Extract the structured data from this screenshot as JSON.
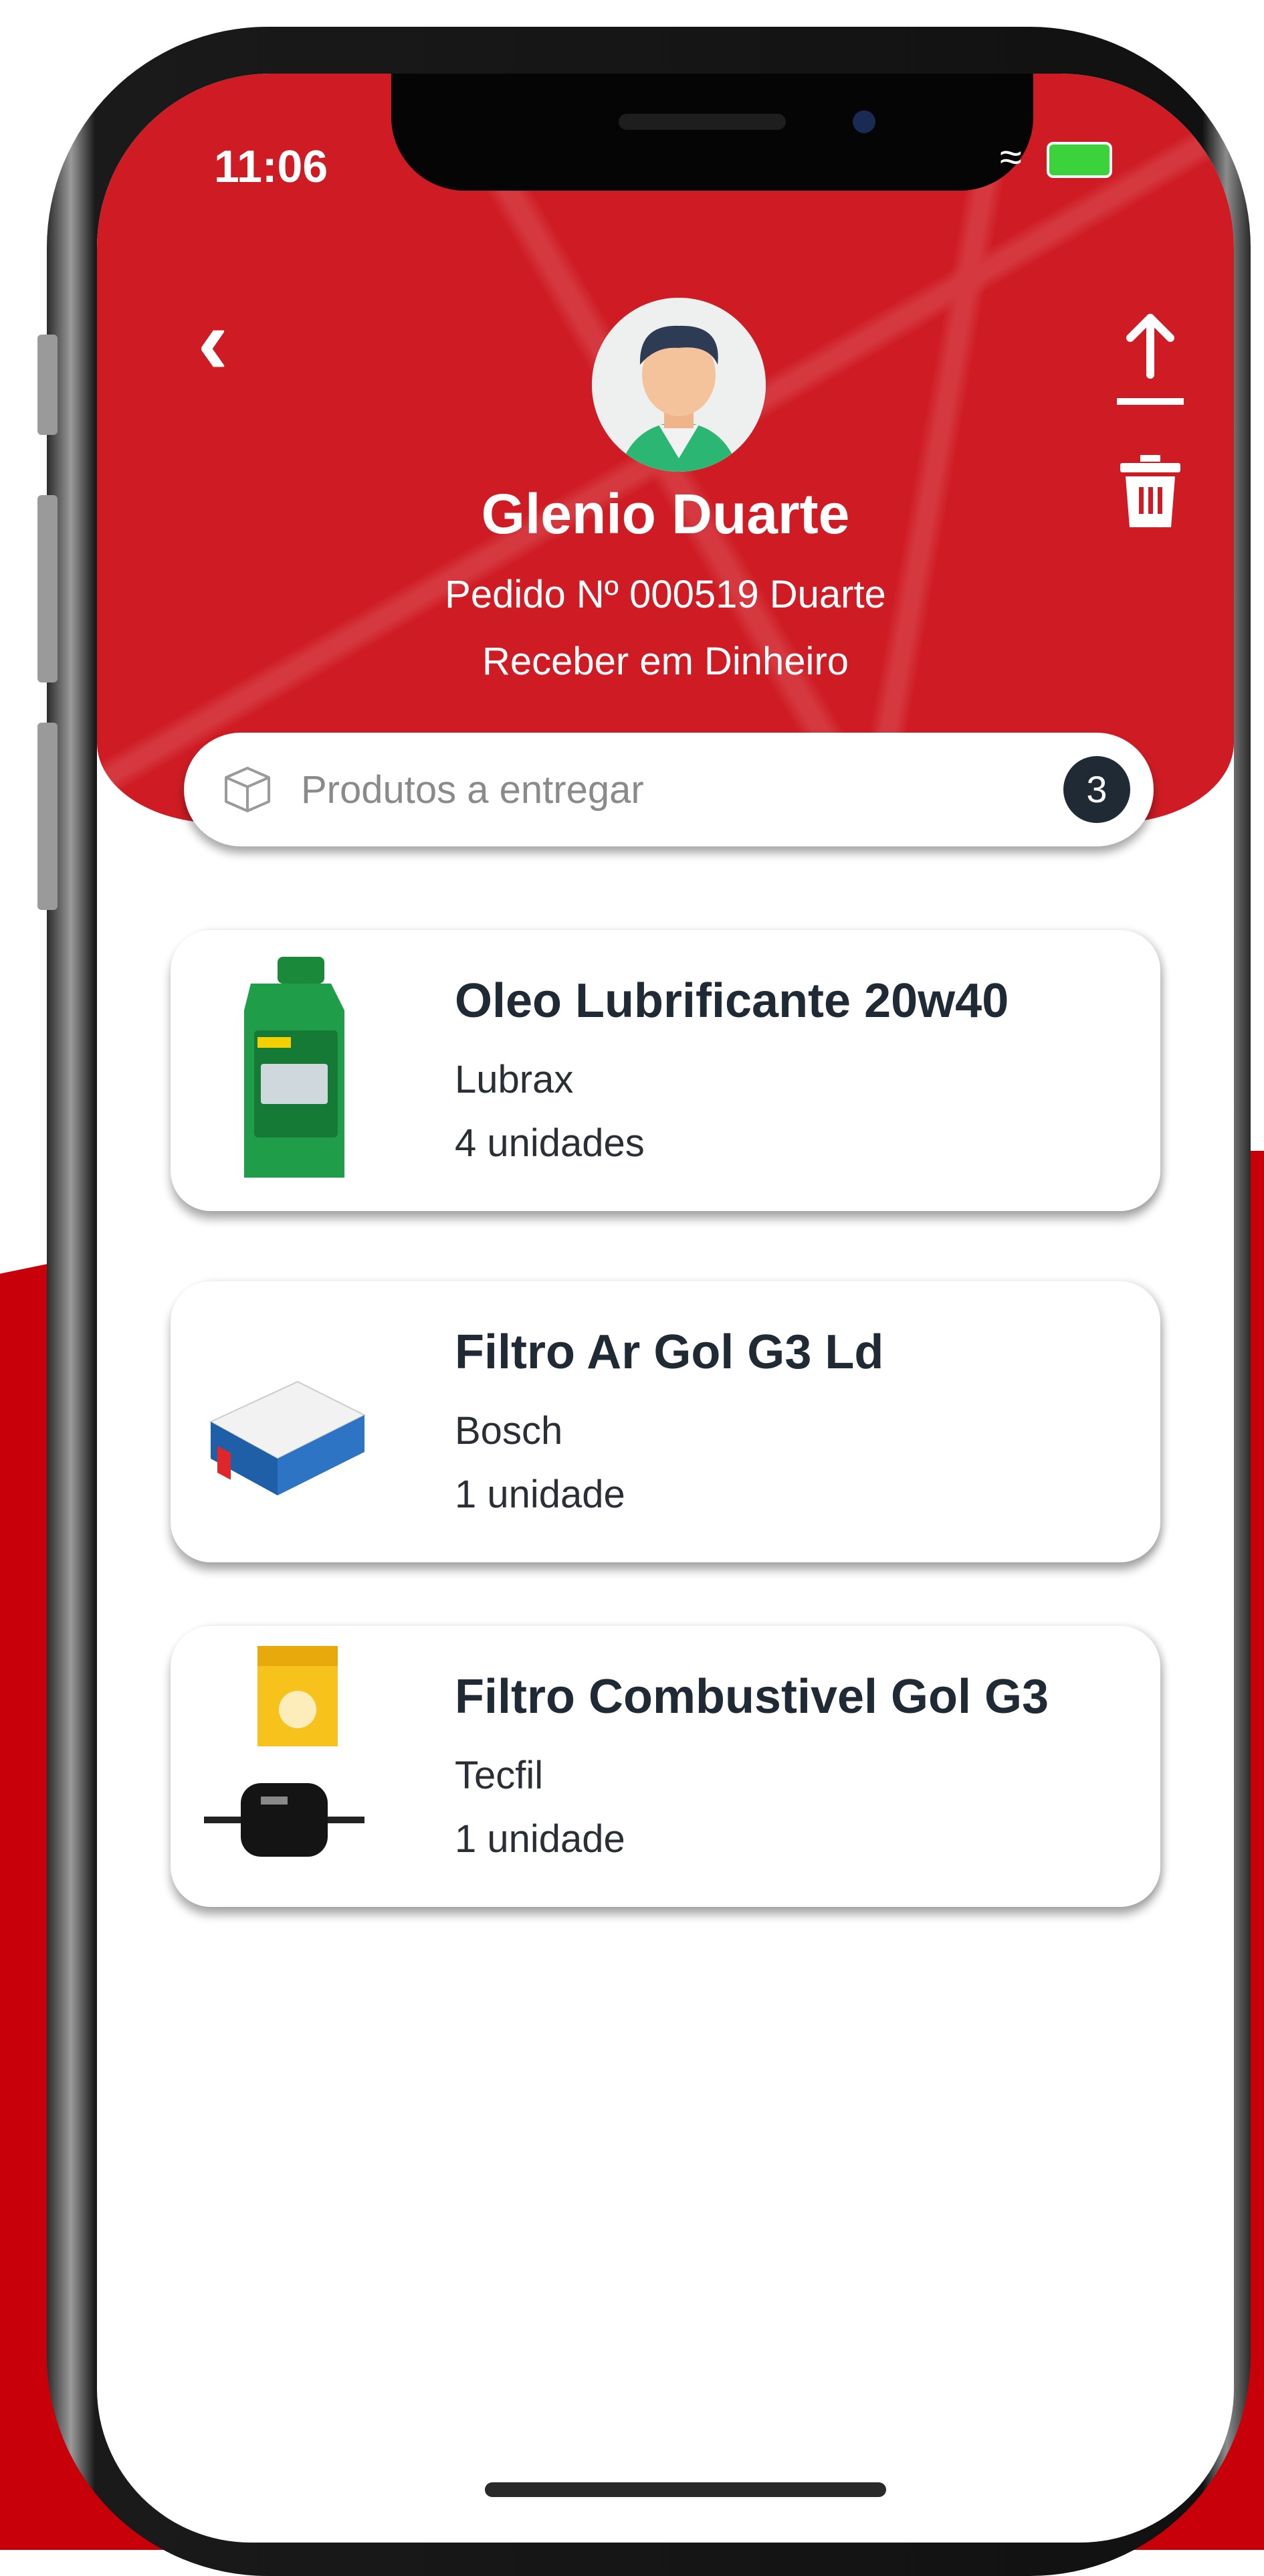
{
  "status_bar": {
    "time": "11:06"
  },
  "header": {
    "customer_name": "Glenio Duarte",
    "order_line": "Pedido Nº 000519 Duarte",
    "payment_line": "Receber em Dinheiro"
  },
  "search": {
    "placeholder": "Produtos a entregar",
    "count": "3"
  },
  "products": [
    {
      "name": "Oleo Lubrificante 20w40",
      "brand": "Lubrax",
      "quantity": "4 unidades"
    },
    {
      "name": "Filtro Ar Gol G3 Ld",
      "brand": "Bosch",
      "quantity": "1 unidade"
    },
    {
      "name": "Filtro Combustivel Gol G3",
      "brand": "Tecfil",
      "quantity": "1 unidade"
    }
  ],
  "colors": {
    "header_red": "#cf1c24",
    "background_red": "#c8000a",
    "badge_dark": "#1f2a35",
    "card_white": "#ffffff"
  },
  "icons": [
    "back-chevron-icon",
    "share-upload-icon",
    "trash-icon",
    "box-icon",
    "wifi-icon",
    "battery-icon"
  ]
}
